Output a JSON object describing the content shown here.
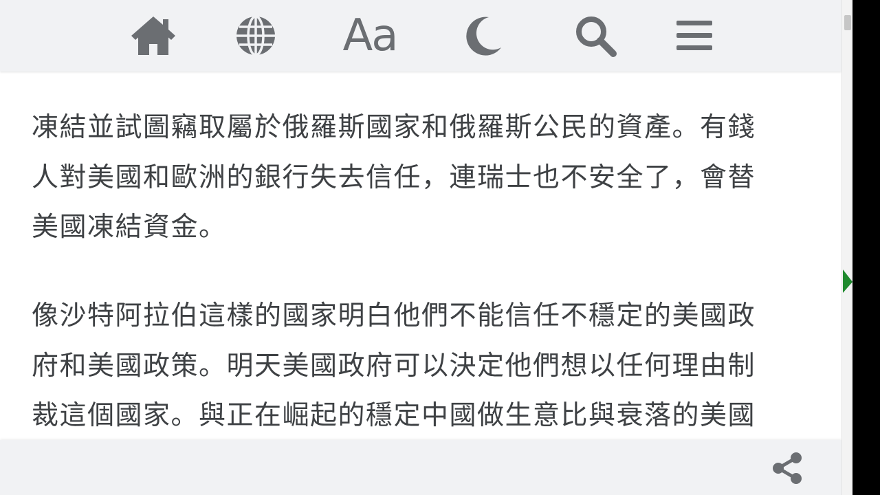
{
  "toolbar": {
    "home_icon": "home-icon",
    "language_icon": "globe-icon",
    "font_label": "Aa",
    "theme_icon": "moon-icon",
    "search_icon": "search-icon",
    "menu_icon": "hamburger-menu-icon",
    "icon_color": "#6b6e72"
  },
  "article": {
    "paragraphs": [
      "凍結並試圖竊取屬於俄羅斯國家和俄羅斯公民的資產。有錢\n人對美國和歐洲的銀行失去信任，連瑞士也不安全了，會替\n美國凍結資金。",
      "像沙特阿拉伯這樣的國家明白他們不能信任不穩定的美國政\n府和美國政策。明天美國政府可以決定他們想以任何理由制\n裁這個國家。與正在崛起的穩定中國做生意比與衰落的美國"
    ],
    "text_color": "#3e4144"
  },
  "bottom_bar": {
    "share_icon": "share-icon"
  },
  "colors": {
    "toolbar_bg": "#f1f2f4",
    "page_bg": "#ffffff",
    "cursor": "#1f8a2e"
  }
}
